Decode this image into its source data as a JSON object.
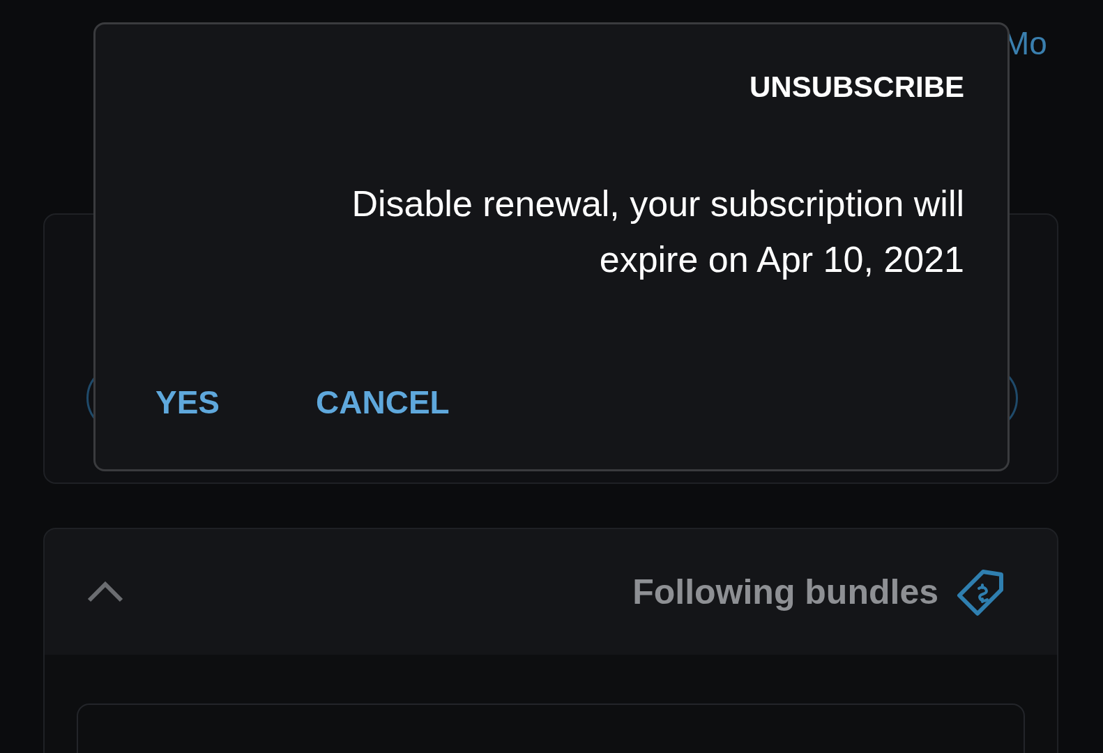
{
  "top_link": "Mo",
  "dialog": {
    "title": "UNSUBSCRIBE",
    "message": "Disable renewal, your subscription will expire on Apr 10, 2021",
    "buttons": [
      "YES",
      "CANCEL"
    ]
  },
  "bundles": {
    "title": "Following bundles",
    "expanded": true
  }
}
